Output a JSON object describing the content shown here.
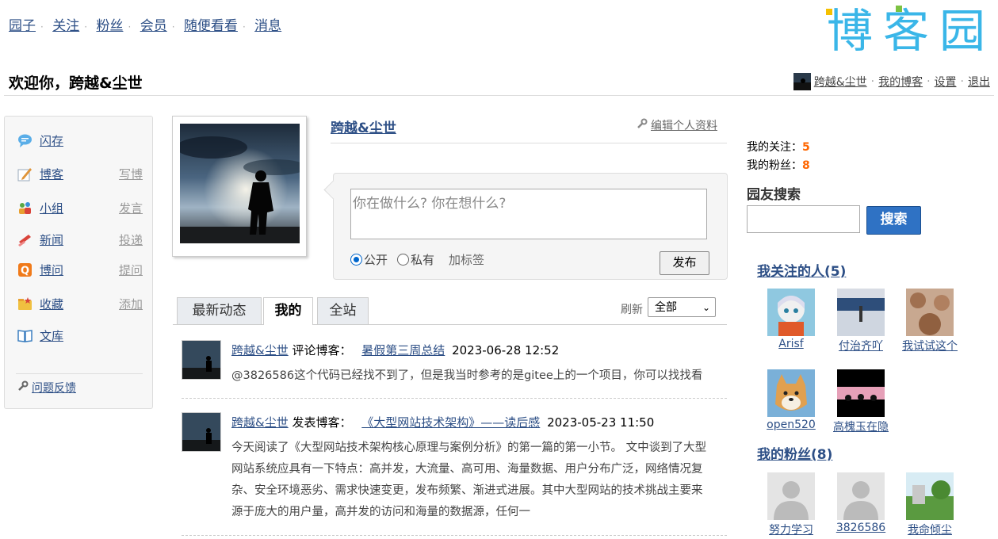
{
  "top_nav": [
    "园子",
    "关注",
    "粉丝",
    "会员",
    "随便看看",
    "消息"
  ],
  "logo": {
    "text": "博客园"
  },
  "welcome": "欢迎你，跨越&尘世",
  "user_links": {
    "name": "跨越&尘世",
    "my_blog": "我的博客",
    "settings": "设置",
    "logout": "退出"
  },
  "sidebar": {
    "items": [
      {
        "label": "闪存",
        "action": "",
        "icon": "speech-bubble-icon",
        "color": "#3b8fd8"
      },
      {
        "label": "博客",
        "action": "写博",
        "icon": "pencil-note-icon",
        "color": "#e0953a"
      },
      {
        "label": "小组",
        "action": "发言",
        "icon": "group-people-icon",
        "color": "#5aa844"
      },
      {
        "label": "新闻",
        "action": "投递",
        "icon": "news-icon",
        "color": "#d9443a"
      },
      {
        "label": "博问",
        "action": "提问",
        "icon": "question-q-icon",
        "color": "#f07a1a"
      },
      {
        "label": "收藏",
        "action": "添加",
        "icon": "folder-star-icon",
        "color": "#e8a030"
      },
      {
        "label": "文库",
        "action": "",
        "icon": "book-icon",
        "color": "#3c7fc0"
      }
    ],
    "feedback": "问题反馈"
  },
  "profile": {
    "name": "跨越&尘世",
    "edit": "编辑个人资料"
  },
  "post_box": {
    "placeholder": "你在做什么? 你在想什么?",
    "public_label": "公开",
    "private_label": "私有",
    "tag_label": "加标签",
    "submit": "发布"
  },
  "tabs": {
    "items": [
      "最新动态",
      "我的",
      "全站"
    ],
    "active": "我的",
    "refresh": "刷新",
    "filter": "全部"
  },
  "feed": [
    {
      "user": "跨越&尘世",
      "action": "评论博客：",
      "title": "暑假第三周总结",
      "time": "2023-06-28 12:52",
      "body": [
        "@3826586这个代码已经找不到了，但是我当时参考的是gitee上的一个项目，你可以找找看"
      ]
    },
    {
      "user": "跨越&尘世",
      "action": "发表博客：",
      "title": "《大型网站技术架构》——读后感",
      "time": "2023-05-23 11:50",
      "body": [
        "今天阅读了《大型网站技术架构核心原理与案例分析》的第一篇的第一小节。 文中谈到了大型",
        "网站系统应具有一下特点：高并发，大流量、高可用、海量数据、用户分布广泛，网络情况复",
        "杂、安全环境恶劣、需求快速变更，发布频繁、渐进式进展。其中大型网站的技术挑战主要来",
        "源于庞大的用户量，高并发的访问和海量的数据源，任何一"
      ]
    }
  ],
  "right": {
    "following_label": "我的关注：",
    "following_count": "5",
    "followers_label": "我的粉丝：",
    "followers_count": "8",
    "search_title": "园友搜索",
    "search_btn": "搜索",
    "following_title": "我关注的人(5)",
    "following": [
      "Arisf",
      "付治齐吖",
      "我试试这个",
      "open520",
      "高槐玉在隐"
    ],
    "followers_title": "我的粉丝(8)",
    "followers": [
      "努力学习",
      "3826586",
      "我命倾尘"
    ]
  }
}
